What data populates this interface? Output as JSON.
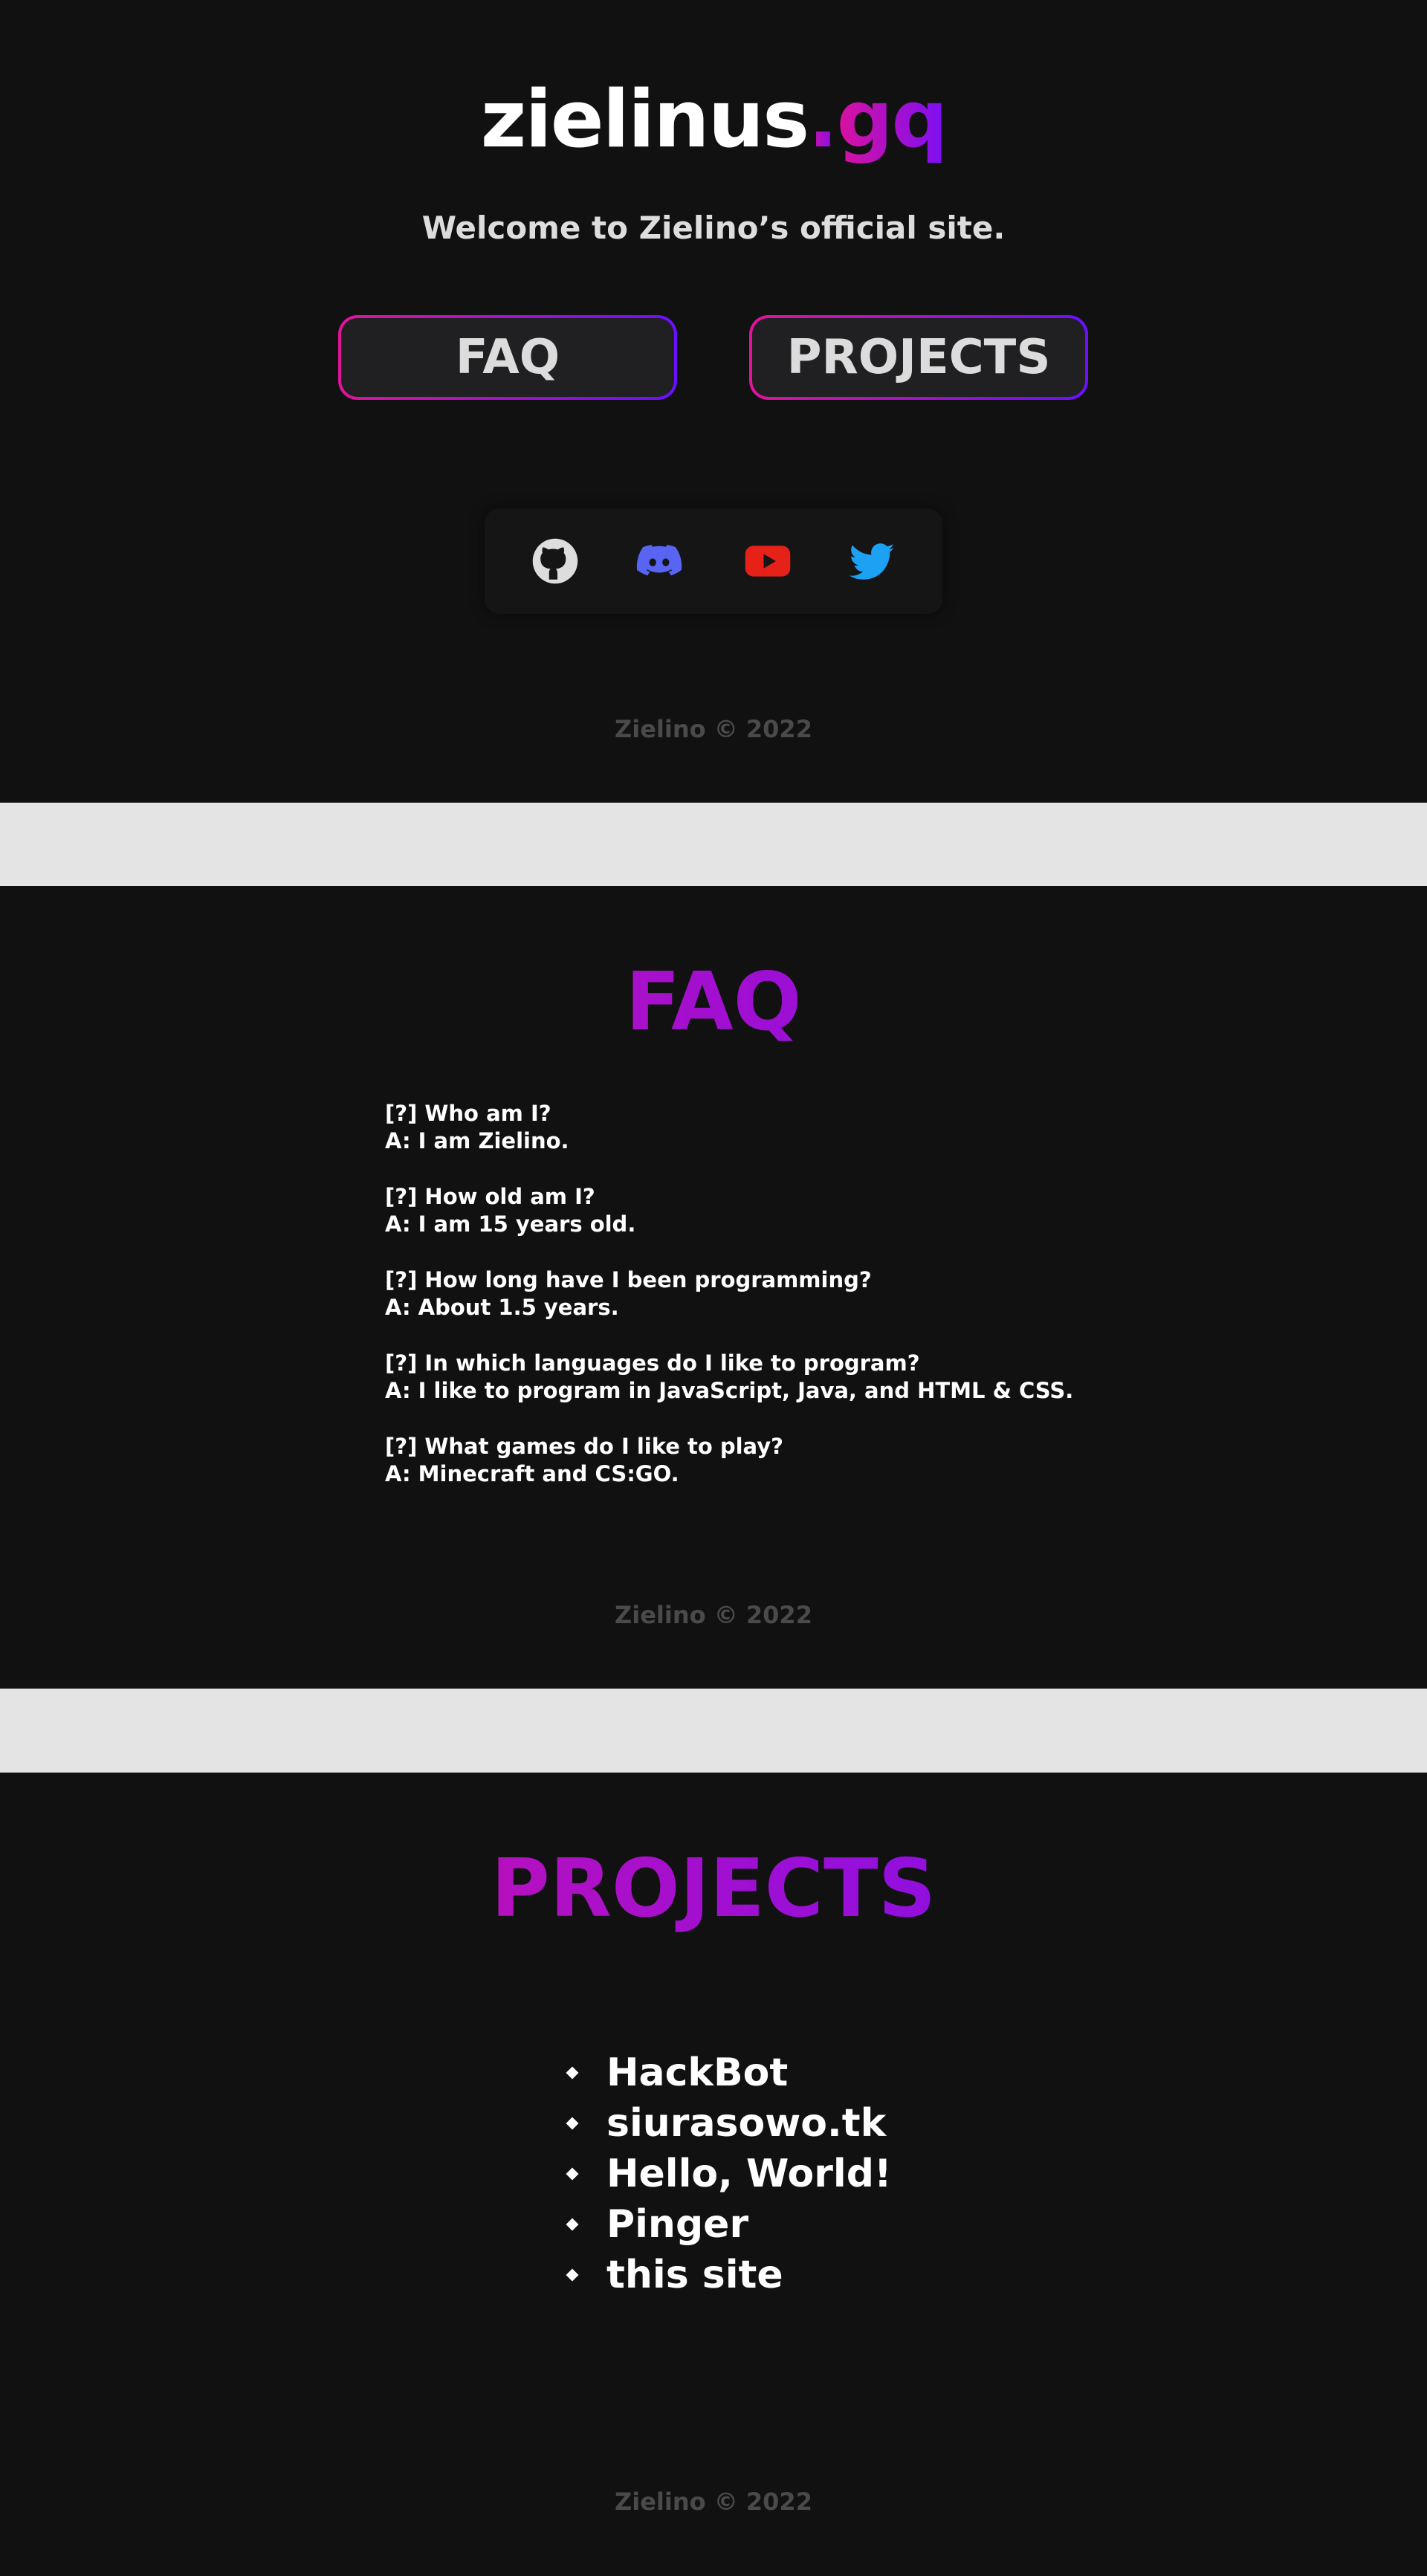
{
  "home": {
    "logo": {
      "name": "zielinus",
      "dot": ".",
      "tld": "gq"
    },
    "welcome": "Welcome to Zielino’s official site.",
    "nav": {
      "faq_label": "FAQ",
      "projects_label": "PROJECTS"
    },
    "social": [
      {
        "icon": "github-icon",
        "color": "#dddddd"
      },
      {
        "icon": "discord-icon",
        "color": "#5865f2"
      },
      {
        "icon": "youtube-icon",
        "color": "#e62117"
      },
      {
        "icon": "twitter-icon",
        "color": "#1da1f2"
      }
    ],
    "footer": "Zielino © 2022"
  },
  "faq": {
    "title": "FAQ",
    "items": [
      {
        "q": "[?] Who am I?",
        "a": "A: I am Zielino."
      },
      {
        "q": "[?] How old am I?",
        "a": "A: I am 15 years old."
      },
      {
        "q": "[?] How long have I been programming?",
        "a": "A: About 1.5 years."
      },
      {
        "q": "[?] In which languages do I like to program?",
        "a": "A: I like to program in JavaScript, Java, and HTML & CSS."
      },
      {
        "q": "[?] What games do I like to play?",
        "a": "A: Minecraft and CS:GO."
      }
    ],
    "footer": "Zielino © 2022"
  },
  "projects": {
    "title": "PROJECTS",
    "items": [
      "HackBot",
      "siurasowo.tk",
      "Hello, World!",
      "Pinger",
      "this site"
    ],
    "footer": "Zielino © 2022"
  },
  "colors": {
    "background": "#111112",
    "separator": "#e4e4e4",
    "gradient_start": "#e0149a",
    "gradient_end": "#6a10ff"
  }
}
